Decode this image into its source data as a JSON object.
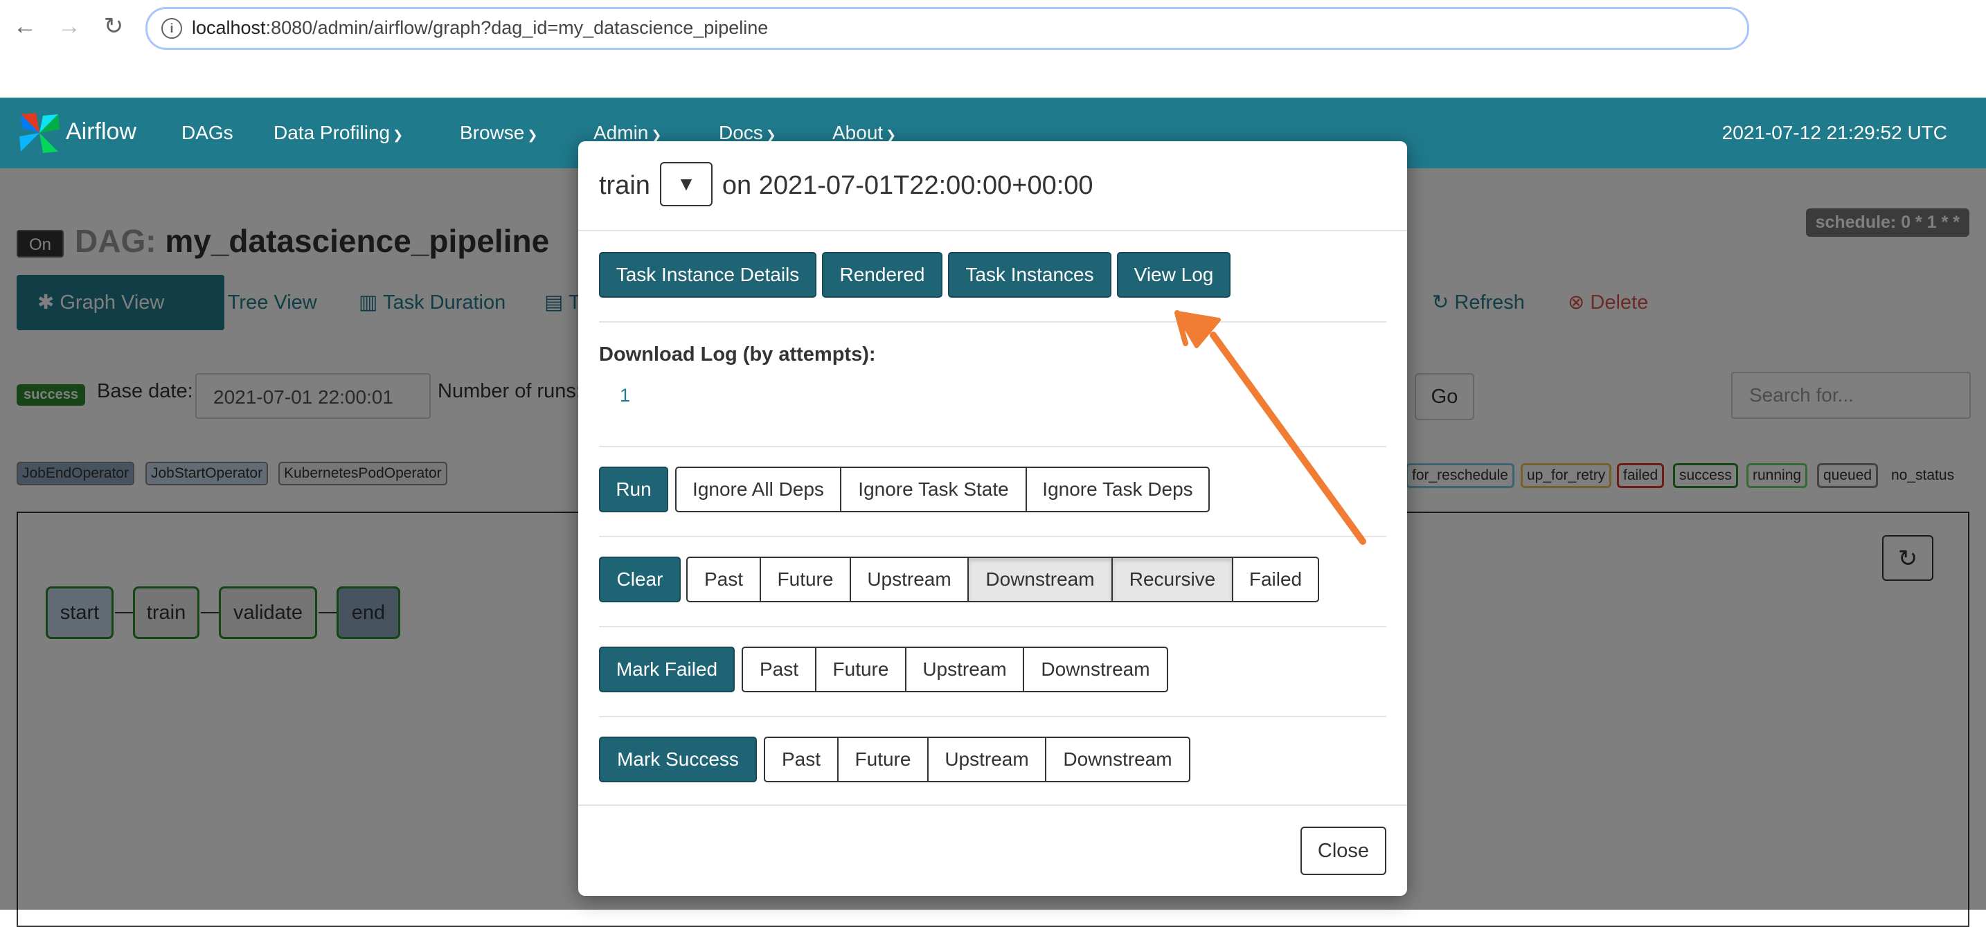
{
  "browser": {
    "url_host": "localhost",
    "url_path": ":8080/admin/airflow/graph?dag_id=my_datascience_pipeline"
  },
  "navbar": {
    "brand": "Airflow",
    "items": [
      {
        "label": "DAGs",
        "dropdown": false
      },
      {
        "label": "Data Profiling",
        "dropdown": true
      },
      {
        "label": "Browse",
        "dropdown": true
      },
      {
        "label": "Admin",
        "dropdown": true
      },
      {
        "label": "Docs",
        "dropdown": true
      },
      {
        "label": "About",
        "dropdown": true
      }
    ],
    "clock": "2021-07-12 21:29:52 UTC"
  },
  "dag": {
    "toggle": "On",
    "title_label": "DAG:",
    "title_name": "my_datascience_pipeline",
    "schedule": "schedule: 0 * 1 * *"
  },
  "tabs": [
    {
      "label": "Graph View",
      "icon": "asterisk-icon",
      "active": true
    },
    {
      "label": "Tree View",
      "icon": "tree-icon"
    },
    {
      "label": "Task Duration",
      "icon": "bar-chart-icon"
    },
    {
      "label": "T",
      "icon": "file-icon"
    },
    {
      "label": "Refresh",
      "icon": "refresh-icon"
    },
    {
      "label": "Delete",
      "icon": "remove-circle-icon"
    }
  ],
  "controls": {
    "status_badge": "success",
    "base_date_label": "Base date:",
    "base_date_value": "2021-07-01 22:00:01",
    "runs_label": "Number of runs:",
    "go_label": "Go",
    "search_placeholder": "Search for..."
  },
  "operators_legend": [
    "JobEndOperator",
    "JobStartOperator",
    "KubernetesPodOperator"
  ],
  "status_legend": [
    "for_reschedule",
    "up_for_retry",
    "failed",
    "success",
    "running",
    "queued",
    "no_status"
  ],
  "graph": {
    "nodes": [
      "start",
      "train",
      "validate",
      "end"
    ]
  },
  "modal": {
    "task": "train",
    "on_text": "on 2021-07-01T22:00:00+00:00",
    "top_buttons": [
      "Task Instance Details",
      "Rendered",
      "Task Instances",
      "View Log"
    ],
    "download_label": "Download Log (by attempts):",
    "attempt": "1",
    "run_row": {
      "primary": "Run",
      "options": [
        "Ignore All Deps",
        "Ignore Task State",
        "Ignore Task Deps"
      ]
    },
    "clear_row": {
      "primary": "Clear",
      "options": [
        "Past",
        "Future",
        "Upstream",
        "Downstream",
        "Recursive",
        "Failed"
      ]
    },
    "failed_row": {
      "primary": "Mark Failed",
      "options": [
        "Past",
        "Future",
        "Upstream",
        "Downstream"
      ]
    },
    "success_row": {
      "primary": "Mark Success",
      "options": [
        "Past",
        "Future",
        "Upstream",
        "Downstream"
      ]
    },
    "close_label": "Close"
  },
  "colors": {
    "navbar": "#1f7a8c",
    "primary_button": "#1f6475",
    "annotation_arrow": "#f07d33"
  }
}
